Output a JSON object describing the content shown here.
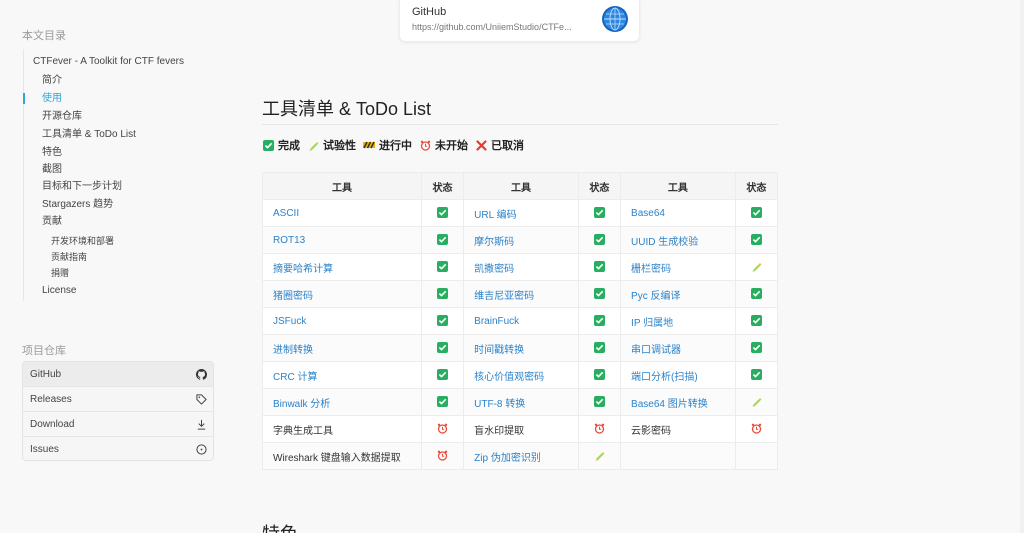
{
  "sidebar": {
    "toc_title": "本文目录",
    "toc": [
      {
        "label": "CTFever - A Toolkit for CTF fevers",
        "level": 0
      },
      {
        "label": "简介",
        "level": 1
      },
      {
        "label": "使用",
        "level": 1,
        "active": true
      },
      {
        "label": "开源仓库",
        "level": 1
      },
      {
        "label": "工具清单 & ToDo List",
        "level": 1
      },
      {
        "label": "特色",
        "level": 1
      },
      {
        "label": "截图",
        "level": 1
      },
      {
        "label": "目标和下一步计划",
        "level": 1
      },
      {
        "label": "Stargazers 趋势",
        "level": 1
      },
      {
        "label": "贡献",
        "level": 1
      },
      {
        "label": "开发环境和部署",
        "level": 2
      },
      {
        "label": "贡献指南",
        "level": 2
      },
      {
        "label": "捐赠",
        "level": 2
      },
      {
        "label": "License",
        "level": 1
      }
    ],
    "repo_title": "项目仓库",
    "repo_links": [
      {
        "label": "GitHub",
        "icon": "github-icon"
      },
      {
        "label": "Releases",
        "icon": "tag-icon"
      },
      {
        "label": "Download",
        "icon": "download-icon"
      },
      {
        "label": "Issues",
        "icon": "issue-icon"
      }
    ]
  },
  "card": {
    "title": "GitHub",
    "url": "https://github.com/UniiemStudio/CTFe..."
  },
  "main": {
    "heading": "工具清单 & ToDo List",
    "next_heading": "特色",
    "legend": [
      {
        "status": "done",
        "label": "完成"
      },
      {
        "status": "beta",
        "label": "试验性"
      },
      {
        "status": "wip",
        "label": "进行中"
      },
      {
        "status": "todo",
        "label": "未开始"
      },
      {
        "status": "cancel",
        "label": "已取消"
      }
    ],
    "table": {
      "headers": [
        "工具",
        "状态",
        "工具",
        "状态",
        "工具",
        "状态"
      ],
      "rows": [
        [
          {
            "t": "ASCII",
            "s": "done",
            "link": true
          },
          {
            "t": "URL 编码",
            "s": "done",
            "link": true
          },
          {
            "t": "Base64",
            "s": "done",
            "link": true
          }
        ],
        [
          {
            "t": "ROT13",
            "s": "done",
            "link": true
          },
          {
            "t": "摩尔斯码",
            "s": "done",
            "link": true
          },
          {
            "t": "UUID 生成校验",
            "s": "done",
            "link": true
          }
        ],
        [
          {
            "t": "摘要哈希计算",
            "s": "done",
            "link": true
          },
          {
            "t": "凯撒密码",
            "s": "done",
            "link": true
          },
          {
            "t": "栅栏密码",
            "s": "beta",
            "link": true
          }
        ],
        [
          {
            "t": "猪圈密码",
            "s": "done",
            "link": true
          },
          {
            "t": "维吉尼亚密码",
            "s": "done",
            "link": true
          },
          {
            "t": "Pyc 反编译",
            "s": "done",
            "link": true
          }
        ],
        [
          {
            "t": "JSFuck",
            "s": "done",
            "link": true
          },
          {
            "t": "BrainFuck",
            "s": "done",
            "link": true
          },
          {
            "t": "IP 归属地",
            "s": "done",
            "link": true
          }
        ],
        [
          {
            "t": "进制转换",
            "s": "done",
            "link": true
          },
          {
            "t": "时间戳转换",
            "s": "done",
            "link": true
          },
          {
            "t": "串口调试器",
            "s": "done",
            "link": true
          }
        ],
        [
          {
            "t": "CRC 计算",
            "s": "done",
            "link": true
          },
          {
            "t": "核心价值观密码",
            "s": "done",
            "link": true
          },
          {
            "t": "端口分析(扫描)",
            "s": "done",
            "link": true
          }
        ],
        [
          {
            "t": "Binwalk 分析",
            "s": "done",
            "link": true
          },
          {
            "t": "UTF-8 转换",
            "s": "done",
            "link": true
          },
          {
            "t": "Base64 图片转换",
            "s": "beta",
            "link": true
          }
        ],
        [
          {
            "t": "字典生成工具",
            "s": "todo",
            "link": false
          },
          {
            "t": "盲水印提取",
            "s": "todo",
            "link": false
          },
          {
            "t": "云影密码",
            "s": "todo",
            "link": false
          }
        ],
        [
          {
            "t": "Wireshark 键盘输入数据提取",
            "s": "todo",
            "link": false
          },
          {
            "t": "Zip 伪加密识别",
            "s": "beta",
            "link": true
          },
          {
            "t": "",
            "s": "",
            "link": false
          }
        ]
      ]
    }
  },
  "colors": {
    "accent": "#2aa8d8",
    "link": "#2b82c9",
    "done": "#27ae60",
    "todo": "#e74c3c",
    "cancel": "#e53935"
  }
}
